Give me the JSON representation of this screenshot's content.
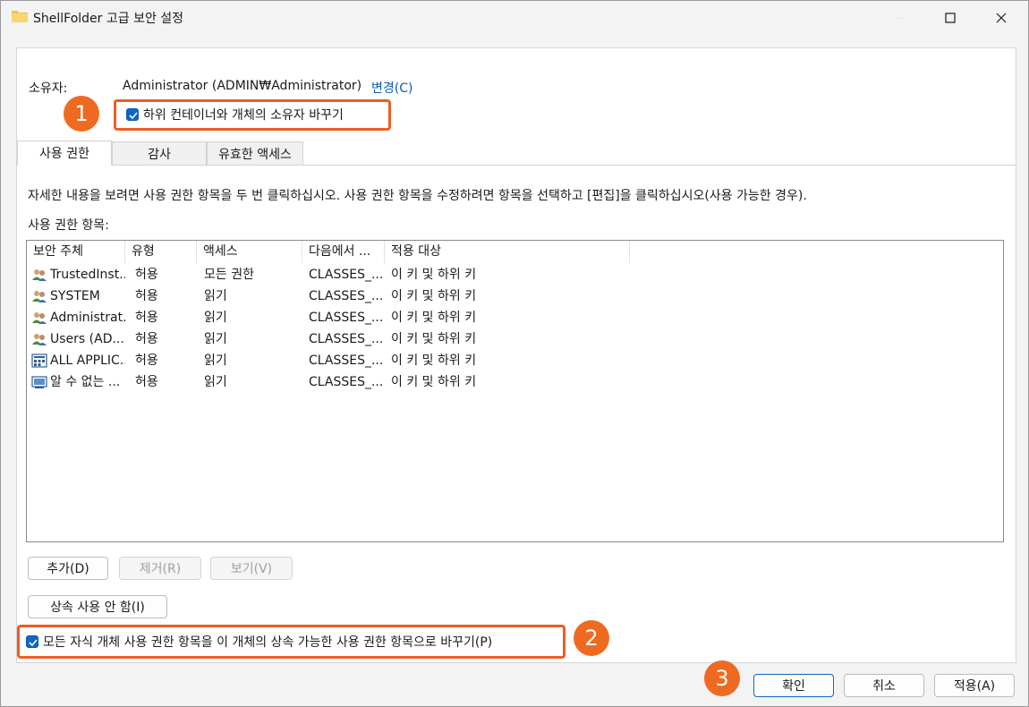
{
  "window": {
    "title": "ShellFolder 고급 보안 설정"
  },
  "owner": {
    "label": "소유자:",
    "value": "Administrator (ADMIN₩Administrator)",
    "change_link": "변경(C)",
    "replace_owner_checkbox": "하위 컨테이너와 개체의 소유자 바꾸기",
    "replace_owner_checked": true
  },
  "tabs": [
    {
      "label": "사용 권한",
      "active": true
    },
    {
      "label": "감사",
      "active": false
    },
    {
      "label": "유효한 액세스",
      "active": false
    }
  ],
  "description": "자세한 내용을 보려면 사용 권한 항목을 두 번 클릭하십시오. 사용 권한 항목을 수정하려면 항목을 선택하고 [편집]을 클릭하십시오(사용 가능한 경우).",
  "permission_list": {
    "label": "사용 권한 항목:",
    "columns": [
      "보안 주체",
      "유형",
      "액세스",
      "다음에서 ...",
      "적용 대상"
    ],
    "rows": [
      {
        "icon": "users-icon",
        "principal": "TrustedInst...",
        "type": "허용",
        "access": "모든 권한",
        "inherited_from": "CLASSES_...",
        "applies_to": "이 키 및 하위 키"
      },
      {
        "icon": "users-icon",
        "principal": "SYSTEM",
        "type": "허용",
        "access": "읽기",
        "inherited_from": "CLASSES_...",
        "applies_to": "이 키 및 하위 키"
      },
      {
        "icon": "users-icon",
        "principal": "Administrat...",
        "type": "허용",
        "access": "읽기",
        "inherited_from": "CLASSES_...",
        "applies_to": "이 키 및 하위 키"
      },
      {
        "icon": "users-icon",
        "principal": "Users (AD...",
        "type": "허용",
        "access": "읽기",
        "inherited_from": "CLASSES_...",
        "applies_to": "이 키 및 하위 키"
      },
      {
        "icon": "app-package-icon",
        "principal": "ALL APPLIC...",
        "type": "허용",
        "access": "읽기",
        "inherited_from": "CLASSES_...",
        "applies_to": "이 키 및 하위 키"
      },
      {
        "icon": "unknown-account-icon",
        "principal": "알 수 없는 ...",
        "type": "허용",
        "access": "읽기",
        "inherited_from": "CLASSES_...",
        "applies_to": "이 키 및 하위 키"
      }
    ]
  },
  "buttons": {
    "add": "추가(D)",
    "remove": "제거(R)",
    "view": "보기(V)",
    "disable_inheritance": "상속 사용 안 함(I)",
    "ok": "확인",
    "cancel": "취소",
    "apply": "적용(A)"
  },
  "replace_child_checkbox": "모든 자식 개체 사용 권한 항목을 이 개체의 상속 가능한 사용 권한 항목으로 바꾸기(P)",
  "replace_child_checked": true,
  "annotations": {
    "badge1": "1",
    "badge2": "2",
    "badge3": "3",
    "color": "#ef6a21"
  },
  "colors": {
    "accent": "#0f67c1",
    "link": "#0a5eb8",
    "highlight": "#ee5e22"
  }
}
